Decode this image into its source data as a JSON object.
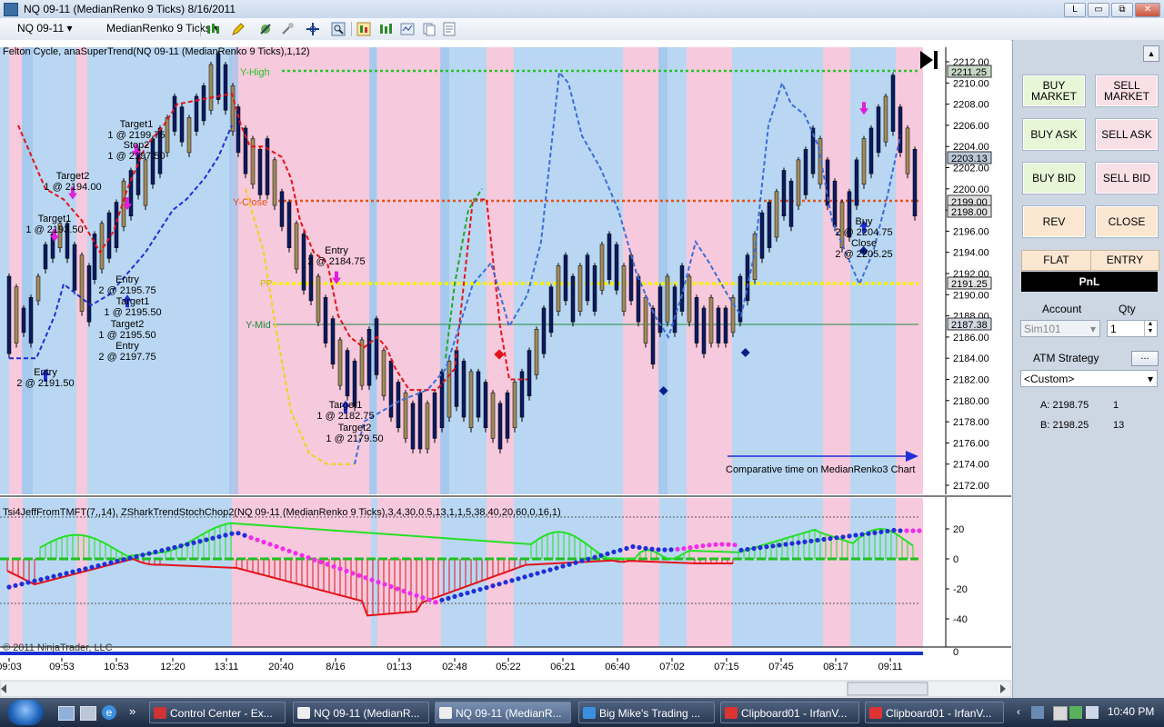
{
  "window": {
    "title": "NQ 09-11 (MedianRenko 9 Ticks)  8/16/2011",
    "btn_l": "L",
    "btn_min": "▭",
    "btn_max": "⧉",
    "btn_close": "✕"
  },
  "toolbar": {
    "instrument": "NQ 09-11",
    "bartype": "MedianRenko 9 Ticks"
  },
  "chart": {
    "price_label": "Felton Cycle, anaSuperTrend(NQ 09-11 (MedianRenko 9 Ticks),1,12)",
    "lower_label": "Tsi4JeffFromTMFT(7,,14), ZSharkTrendStochChop2(NQ 09-11 (MedianRenko 9 Ticks),3,4,30,0.5,13,1,1,5,38,40,20,60,0,16,1)",
    "copyright": "© 2011 NinjaTrader, LLC",
    "y_high": "Y-High",
    "y_close": "Y-Close",
    "y_mid": "Y-Mid",
    "pp": "PP",
    "comparative": "Comparative time on MedianRenko3 Chart",
    "price_ticks": [
      "2212.00",
      "2210.00",
      "2208.00",
      "2206.00",
      "2204.00",
      "2202.00",
      "2200.00",
      "2198.00",
      "2196.00",
      "2194.00",
      "2192.00",
      "2190.00",
      "2188.00",
      "2186.00",
      "2184.00",
      "2182.00",
      "2180.00",
      "2178.00",
      "2176.00",
      "2174.00",
      "2172.00"
    ],
    "price_markers": [
      "2211.25",
      "2203.13",
      "2199.00",
      "2198.00",
      "2191.25",
      "2187.38"
    ],
    "osc_ticks": [
      "20",
      "0",
      "-20",
      "-40"
    ],
    "osc_zero_mark": "0",
    "time_ticks": [
      "09:03",
      "09:53",
      "10:53",
      "12:20",
      "13:11",
      "20:40",
      "8/16",
      "01:13",
      "02:48",
      "05:22",
      "06:21",
      "06:40",
      "07:02",
      "07:15",
      "07:45",
      "08:17",
      "09:11"
    ],
    "annotations": [
      [
        "Target2",
        "1 @ 2194.00"
      ],
      [
        "Target1",
        "1 @ 2193.50"
      ],
      [
        "Entry",
        "2 @ 2191.50"
      ],
      [
        "Target1",
        "1 @ 2199.75"
      ],
      [
        "Stop2",
        "1 @ 2197.50"
      ],
      [
        "Entry",
        "2 @ 2195.75"
      ],
      [
        "Target1",
        "1 @ 2195.50"
      ],
      [
        "Target2",
        "1 @ 2195.50"
      ],
      [
        "Entry",
        "2 @ 2197.75"
      ],
      [
        "Entry",
        "2 @ 2184.75"
      ],
      [
        "Target1",
        "1 @ 2182.75"
      ],
      [
        "Target2",
        "1 @ 2179.50"
      ],
      [
        "Buy",
        "2 @ 2204.75"
      ],
      [
        "Close",
        "2 @ 2205.25"
      ]
    ]
  },
  "panel": {
    "buy_market": "BUY MARKET",
    "sell_market": "SELL MARKET",
    "buy_ask": "BUY ASK",
    "sell_ask": "SELL ASK",
    "buy_bid": "BUY BID",
    "sell_bid": "SELL BID",
    "rev": "REV",
    "close": "CLOSE",
    "flat": "FLAT",
    "entry": "ENTRY",
    "pnl": "PnL",
    "account_label": "Account",
    "qty_label": "Qty",
    "account_value": "Sim101",
    "qty_value": "1",
    "atm_label": "ATM Strategy",
    "atm_btn": "...",
    "atm_value": "<Custom>",
    "a_label": "A: 2198.75",
    "a_qty": "1",
    "b_label": "B: 2198.25",
    "b_qty": "13"
  },
  "taskbar": {
    "items": [
      "Control Center - Ex...",
      "NQ 09-11 (MedianR...",
      "NQ 09-11 (MedianR...",
      "Big Mike's Trading ...",
      "Clipboard01 - IrfanV...",
      "Clipboard01 - IrfanV..."
    ],
    "clock": "10:40 PM",
    "more": "»"
  },
  "colors": {
    "bull_bg": "#b9d7f2",
    "bear_bg": "#f6c9dc",
    "supertrend_up": "#1f2fd8",
    "supertrend_dn": "#e2141b"
  }
}
